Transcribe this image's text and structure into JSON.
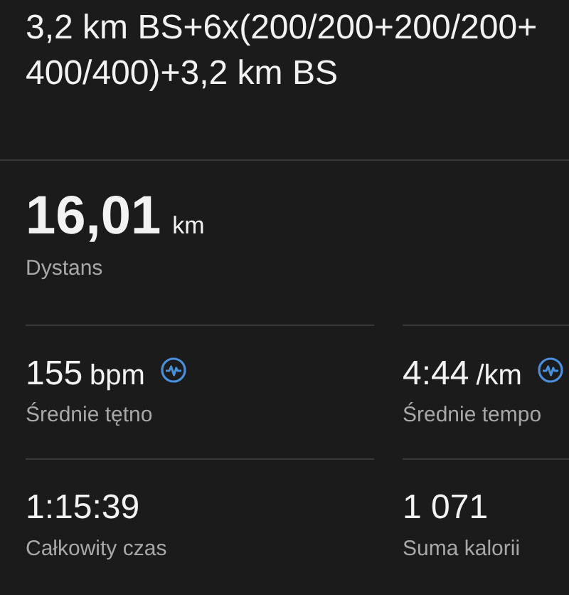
{
  "title": "3,2 km BS+6x(200/200+200/200+400/400)+3,2 km BS",
  "main_stat": {
    "value": "16,01",
    "unit": "km",
    "label": "Dystans"
  },
  "stats": [
    {
      "value": "155",
      "unit": "bpm",
      "label": "Średnie tętno",
      "kind": "chart"
    },
    {
      "value": "4:44",
      "unit": "/km",
      "label": "Średnie tempo",
      "kind": "chart"
    },
    {
      "value": "1:15:39",
      "label": "Całkowity czas",
      "kind": "plain"
    },
    {
      "value": "1 071",
      "label": "Suma kalorii",
      "kind": "plain"
    }
  ]
}
